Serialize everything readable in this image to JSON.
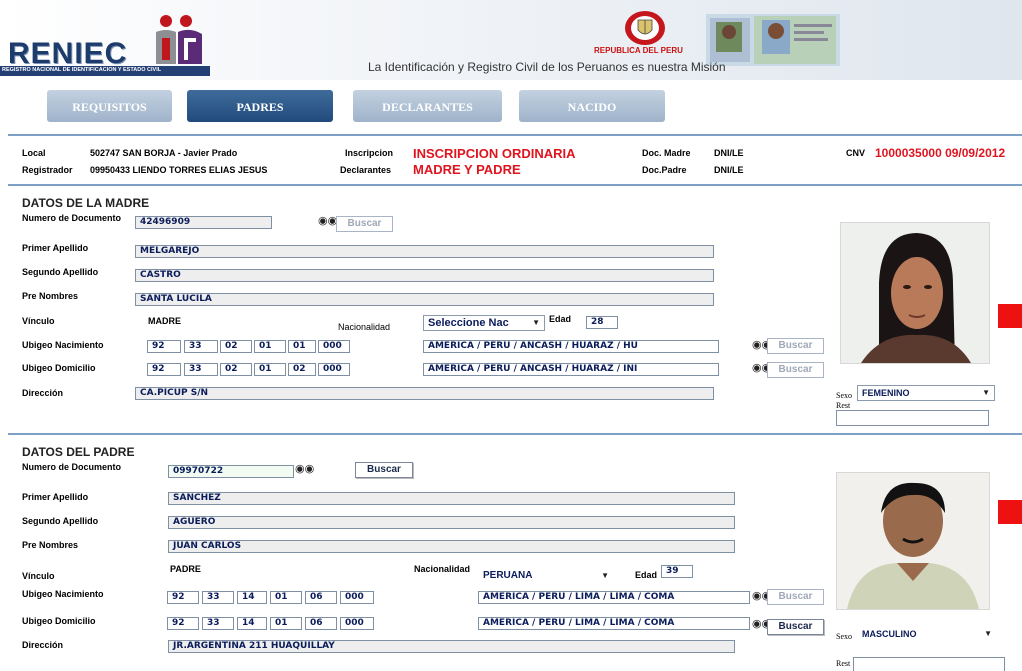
{
  "header": {
    "logo": "RENIEC",
    "logo_subtitle": "REGISTRO NACIONAL DE IDENTIFICACION Y ESTADO CIVIL",
    "republica": "REPUBLICA DEL PERU",
    "mision": "La Identificación y Registro Civil de los Peruanos es nuestra Misión"
  },
  "tabs": [
    {
      "label": "REQUISITOS",
      "active": false
    },
    {
      "label": "PADRES",
      "active": true
    },
    {
      "label": "DECLARANTES",
      "active": false
    },
    {
      "label": "NACIDO",
      "active": false
    }
  ],
  "info": {
    "local_label": "Local",
    "local_value": "502747 SAN BORJA - Javier Prado",
    "registrador_label": "Registrador",
    "registrador_value": "09950433 LIENDO TORRES ELIAS JESUS",
    "inscripcion_label": "Inscripcion",
    "inscripcion_value": "INSCRIPCION ORDINARIA",
    "declarantes_label": "Declarantes",
    "declarantes_value": "MADRE Y PADRE",
    "doc_madre_label": "Doc. Madre",
    "doc_madre_value": "DNI/LE",
    "doc_padre_label": "Doc.Padre",
    "doc_padre_value": "DNI/LE",
    "cnv_label": "CNV",
    "cnv_value": "1000035000 09/09/2012"
  },
  "madre": {
    "title": "DATOS DE LA MADRE",
    "num_doc_label": "Numero de Documento",
    "num_doc": "42496909",
    "buscar": "Buscar",
    "primer_apellido_label": "Primer Apellido",
    "primer_apellido": "MELGAREJO",
    "segundo_apellido_label": "Segundo Apellido",
    "segundo_apellido": "CASTRO",
    "pre_nombres_label": "Pre Nombres",
    "pre_nombres": "SANTA LUCILA",
    "vinculo_label": "Vínculo",
    "vinculo": "MADRE",
    "nacionalidad_label": "Nacionalidad",
    "nacionalidad": "Seleccione Nac",
    "edad_label": "Edad",
    "edad": "28",
    "ubigeo_nac_label": "Ubigeo Nacimiento",
    "ubigeo_nac": [
      "92",
      "33",
      "02",
      "01",
      "01",
      "000"
    ],
    "ubigeo_nac_text": "AMERICA / PERU / ANCASH / HUARAZ / HU",
    "ubigeo_dom_label": "Ubigeo Domicilio",
    "ubigeo_dom": [
      "92",
      "33",
      "02",
      "01",
      "02",
      "000"
    ],
    "ubigeo_dom_text": "AMERICA / PERU / ANCASH / HUARAZ / INI",
    "direccion_label": "Dirección",
    "direccion": "CA.PICUP S/N",
    "sexo_label": "Sexo",
    "sexo": "FEMENINO",
    "rest_label": "Rest"
  },
  "padre": {
    "title": "DATOS DEL PADRE",
    "num_doc_label": "Numero de Documento",
    "num_doc": "09970722",
    "buscar": "Buscar",
    "primer_apellido_label": "Primer Apellido",
    "primer_apellido": "SANCHEZ",
    "segundo_apellido_label": "Segundo Apellido",
    "segundo_apellido": "AGUERO",
    "pre_nombres_label": "Pre Nombres",
    "pre_nombres": "JUAN CARLOS",
    "vinculo_label": "Vínculo",
    "vinculo": "PADRE",
    "nacionalidad_label": "Nacionalidad",
    "nacionalidad": "PERUANA",
    "edad_label": "Edad",
    "edad": "39",
    "ubigeo_nac_label": "Ubigeo Nacimiento",
    "ubigeo_nac": [
      "92",
      "33",
      "14",
      "01",
      "06",
      "000"
    ],
    "ubigeo_nac_text": "AMERICA / PERU / LIMA / LIMA / COMA",
    "ubigeo_dom_label": "Ubigeo Domicilio",
    "ubigeo_dom": [
      "92",
      "33",
      "14",
      "01",
      "06",
      "000"
    ],
    "ubigeo_dom_text": "AMERICA / PERU / LIMA / LIMA / COMA",
    "direccion_label": "Dirección",
    "direccion": "JR.ARGENTINA 211 HUAQUILLAY",
    "sexo_label": "Sexo",
    "sexo": "MASCULINO",
    "rest_label": "Rest"
  },
  "colors": {
    "accent_red": "#e0141e",
    "tab_active": "#2a5587",
    "divider": "#7fa0c5"
  }
}
